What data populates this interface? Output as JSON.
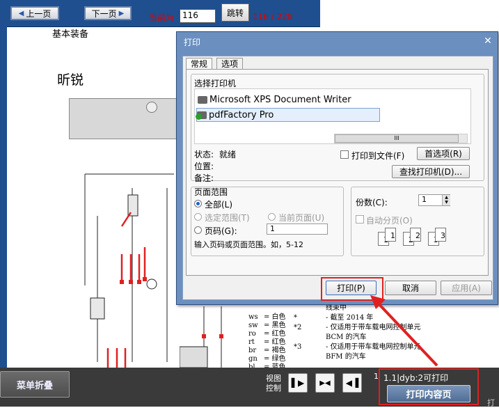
{
  "nav": {
    "prev_label": "上一页",
    "next_label": "下一页",
    "current_label": "当前为",
    "current_value": "116",
    "jump_label": "跳转",
    "page_count": "116 / 228"
  },
  "document": {
    "heading1": "基本装备",
    "heading2": "昕锐",
    "legend_left": [
      {
        "code": "ws",
        "text": "= 白色"
      },
      {
        "code": "sw",
        "text": "= 黑色"
      },
      {
        "code": "ro",
        "text": "= 红色"
      },
      {
        "code": "rt",
        "text": "= 红色"
      },
      {
        "code": "br",
        "text": "= 褐色"
      },
      {
        "code": "gn",
        "text": "= 绿色"
      },
      {
        "code": "bl",
        "text": "= 蓝色"
      }
    ],
    "legend_right": [
      {
        "mark": "",
        "text": "线束中"
      },
      {
        "mark": "*",
        "text": "- 截至 2014 年"
      },
      {
        "mark": "*2",
        "text": "- 仅适用于带车载电网控制单元"
      },
      {
        "mark": "",
        "text": "BCM 的汽车"
      },
      {
        "mark": "*3",
        "text": "- 仅适用于带车载电网控制单元"
      },
      {
        "mark": "",
        "text": "BFM 的汽车"
      }
    ]
  },
  "dialog": {
    "title": "打印",
    "tabs": [
      "常规",
      "选项"
    ],
    "select_printer_label": "选择打印机",
    "printers": [
      "Microsoft XPS Document Writer",
      "pdfFactory Pro"
    ],
    "scroll_glyph": "III",
    "status_label": "状态:",
    "status_value": "就绪",
    "location_label": "位置:",
    "comment_label": "备注:",
    "print_to_file_label": "打印到文件(F)",
    "preferences_label": "首选项(R)",
    "find_printer_label": "查找打印机(D)...",
    "page_range_label": "页面范围",
    "range_all": "全部(L)",
    "range_selection": "选定范围(T)",
    "range_current": "当前页面(U)",
    "range_pages": "页码(G):",
    "pages_value": "1",
    "pages_hint": "输入页码或页面范围。如，5-12",
    "copies_label": "份数(C):",
    "copies_value": "1",
    "collate_label": "自动分页(O)",
    "collate_pages": [
      "1",
      "1",
      "2",
      "2",
      "3",
      "3"
    ],
    "print_label": "打印(P)",
    "cancel_label": "取消",
    "apply_label": "应用(A)"
  },
  "bottom": {
    "menu_collapse_label": "菜单折叠",
    "view_control_label_1": "视图",
    "view_control_label_2": "控制",
    "page_num": "1",
    "print_status": "1.1|dyb:2可打印",
    "print_content_label": "打印内容页",
    "edge_text": "打"
  },
  "colors": {
    "nav_bar": "#1f4f8f",
    "highlight": "#e02020",
    "page_text_red": "#e00000",
    "bottom_bar": "#3a3a3a"
  }
}
